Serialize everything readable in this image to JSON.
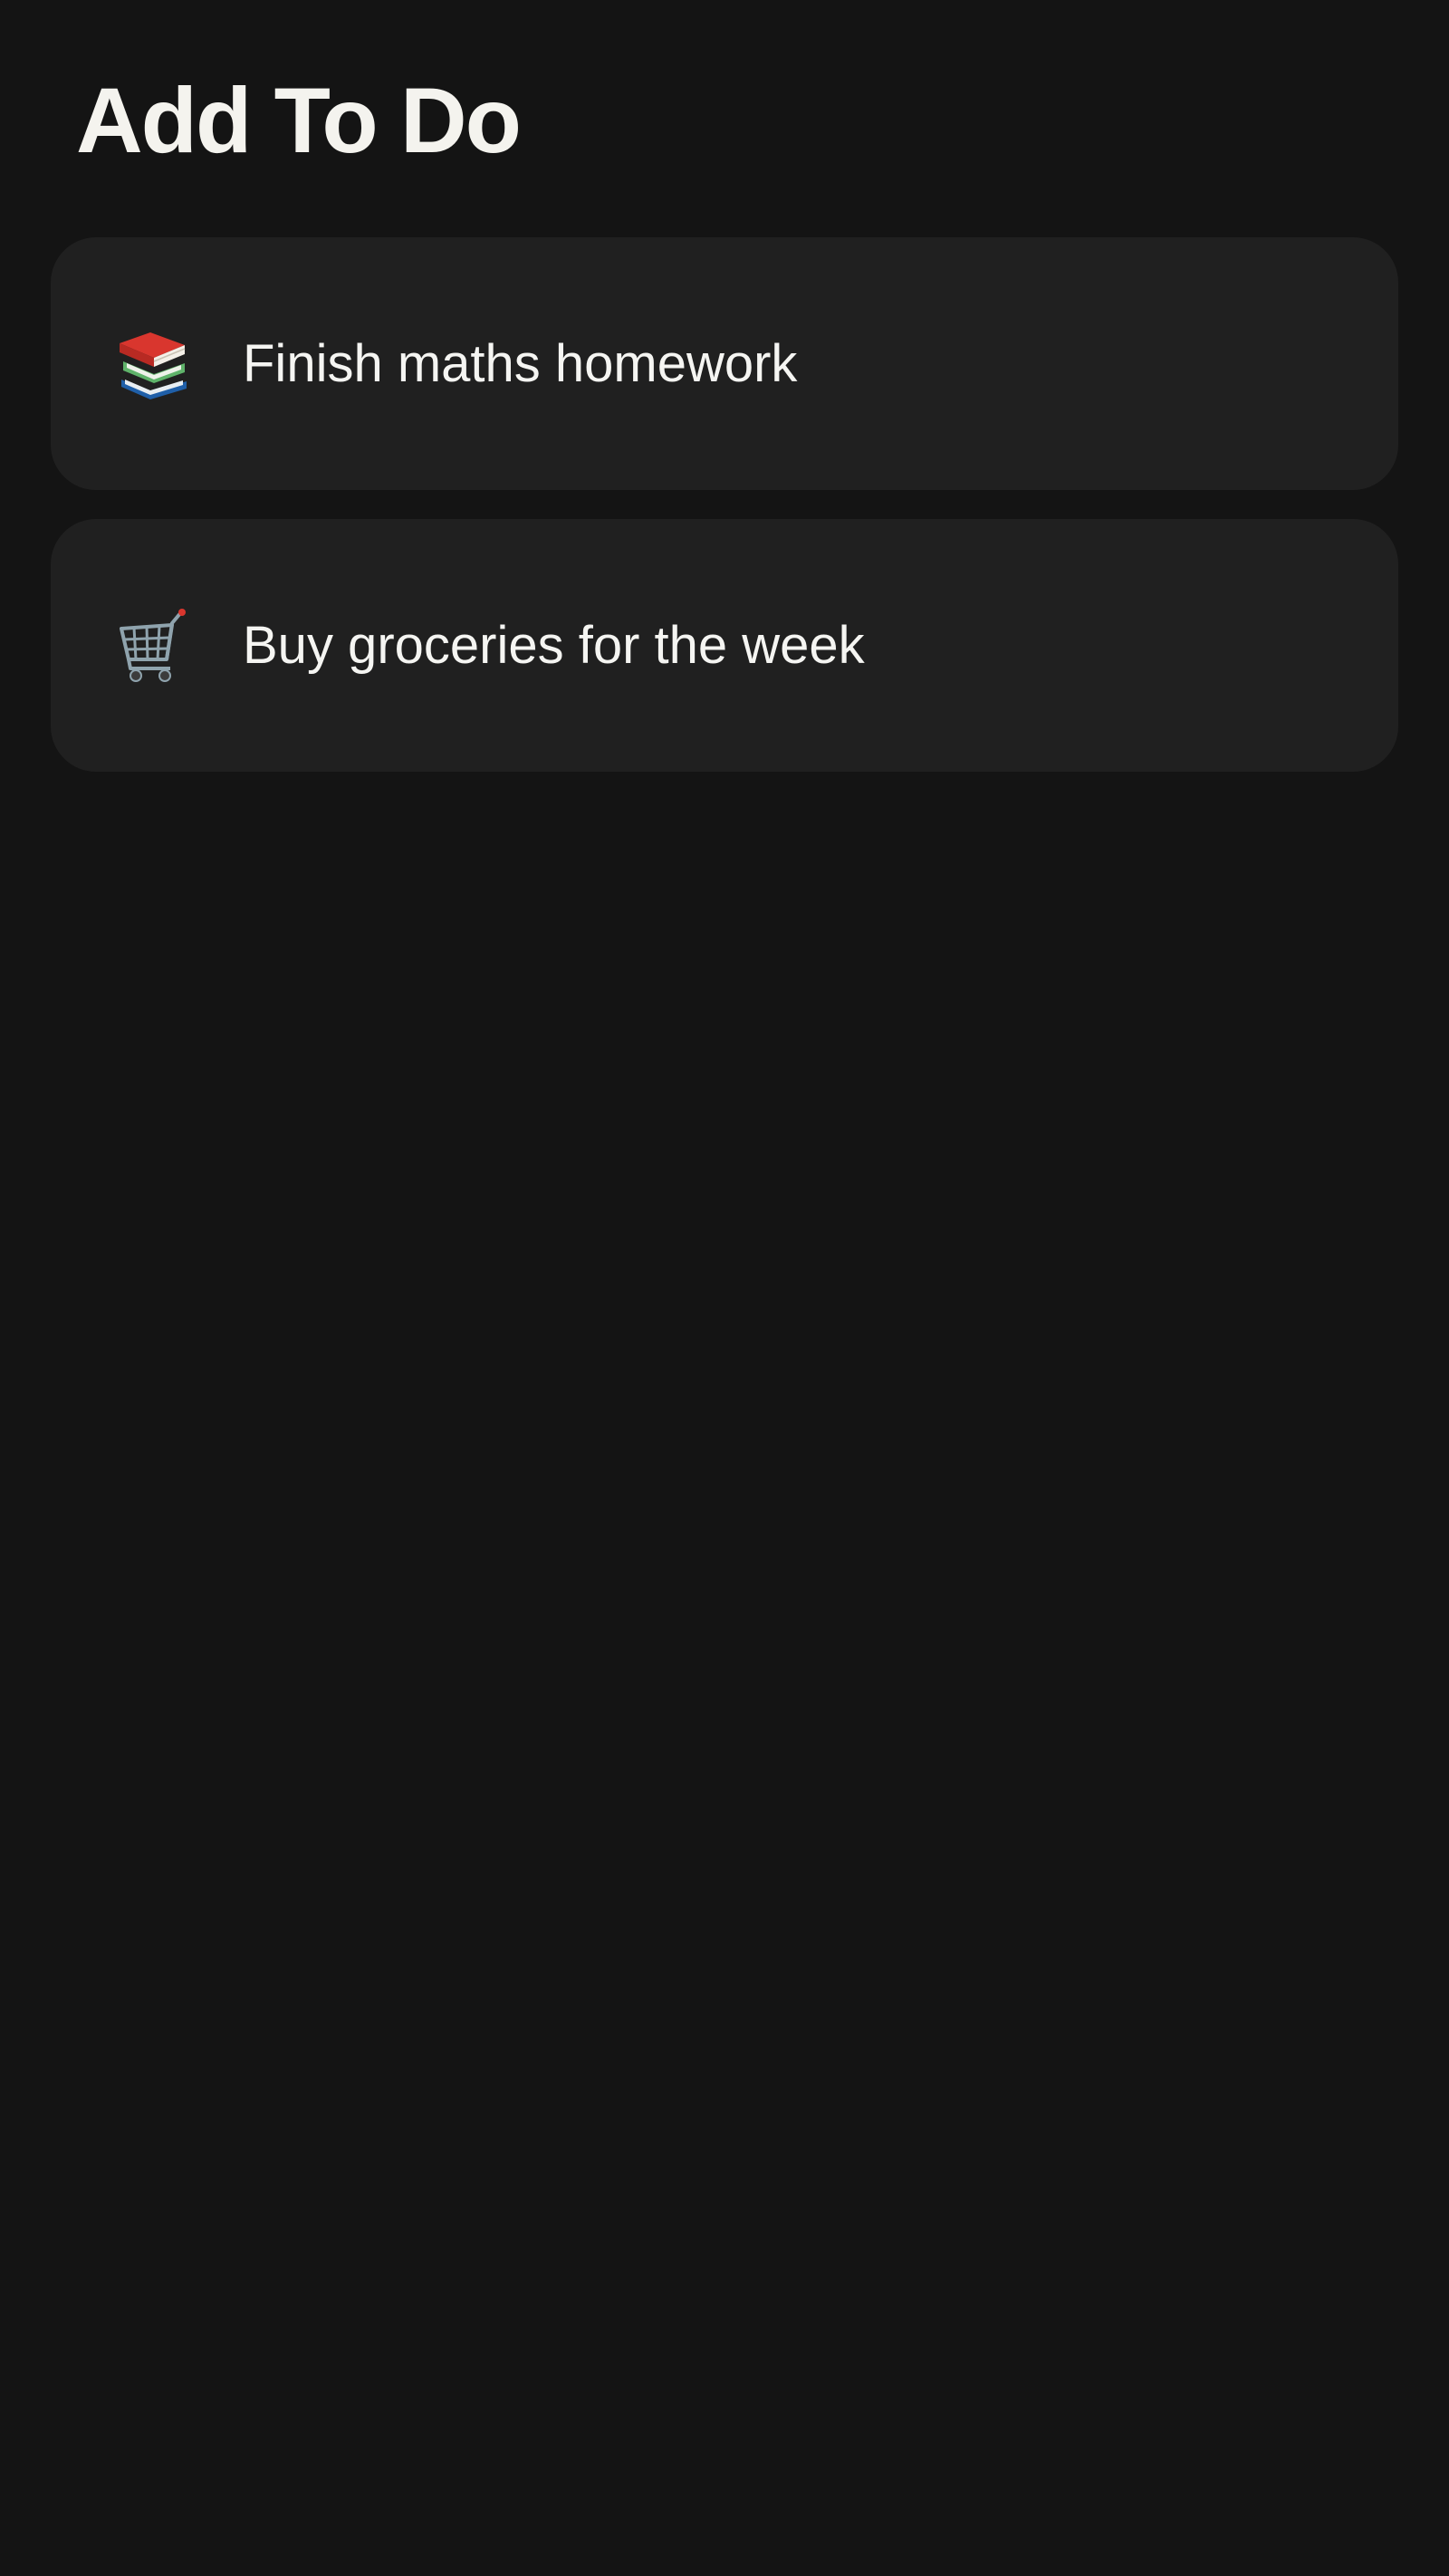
{
  "header": {
    "title": "Add To Do"
  },
  "todos": [
    {
      "label": "Finish maths homework",
      "icon": "books-icon"
    },
    {
      "label": "Buy groceries for the week",
      "icon": "shopping-cart-icon"
    }
  ],
  "colors": {
    "background": "#141414",
    "card": "#202020",
    "text": "#f5f5f2"
  }
}
